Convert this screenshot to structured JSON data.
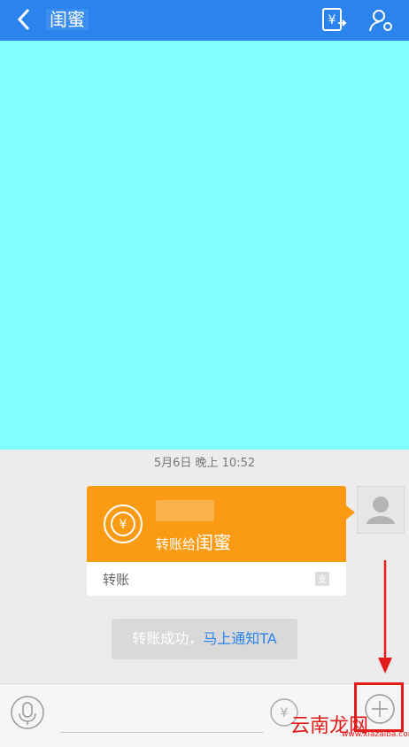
{
  "header": {
    "title": "闺蜜"
  },
  "chat": {
    "date": "5月6日 晚上 10:52",
    "card": {
      "prefix": "转账给",
      "recipient": "闺蜜",
      "footer_label": "转账"
    },
    "notice": {
      "text": "转账成功，",
      "link": "马上通知TA"
    }
  },
  "watermark": {
    "text": "云南龙网",
    "small": "www.xiazaiba.com"
  },
  "colors": {
    "header": "#2b84ee",
    "card": "#fb9b13",
    "canvas": "#80ffff",
    "highlight": "#e31b1b"
  }
}
